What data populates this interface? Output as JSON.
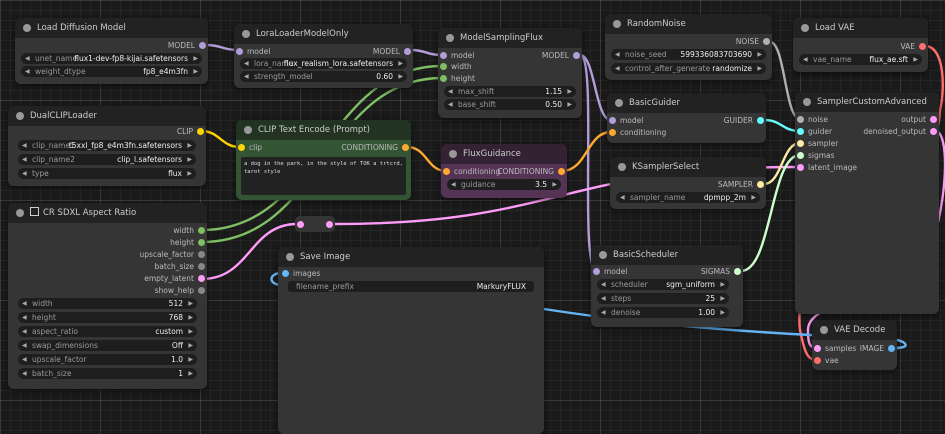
{
  "colors": {
    "model": "#b39ddb",
    "clip": "#ffd500",
    "conditioning": "#ffa931",
    "int": "#7ebf63",
    "latent": "#ff9cf9",
    "noise": "#b0b0b0",
    "guider": "#66ffff",
    "sampler": "#ffeca3",
    "sigmas": "#cdffcd",
    "image": "#64b5f6",
    "vae": "#ff6e6e"
  },
  "nodes": {
    "load_diffusion_model": {
      "title": "Load Diffusion Model",
      "outputs": {
        "model": "MODEL"
      },
      "widgets": {
        "unet_name": {
          "label": "unet_name",
          "value": "flux1-dev-fp8-kijai.safetensors"
        },
        "weight_dtype": {
          "label": "weight_dtype",
          "value": "fp8_e4m3fn"
        }
      }
    },
    "lora_loader": {
      "title": "LoraLoaderModelOnly",
      "inputs": {
        "model": "model"
      },
      "outputs": {
        "model": "MODEL"
      },
      "widgets": {
        "lora_name": {
          "label": "lora_name",
          "value": "flux_realism_lora.safetensors"
        },
        "strength_model": {
          "label": "strength_model",
          "value": "0.60"
        }
      }
    },
    "model_sampling_flux": {
      "title": "ModelSamplingFlux",
      "inputs": {
        "model": "model",
        "width": "width",
        "height": "height"
      },
      "outputs": {
        "model": "MODEL"
      },
      "widgets": {
        "max_shift": {
          "label": "max_shift",
          "value": "1.15"
        },
        "base_shift": {
          "label": "base_shift",
          "value": "0.50"
        }
      }
    },
    "random_noise": {
      "title": "RandomNoise",
      "outputs": {
        "noise": "NOISE"
      },
      "widgets": {
        "noise_seed": {
          "label": "noise_seed",
          "value": "599336083703690"
        },
        "control_after_generate": {
          "label": "control_after_generate",
          "value": "randomize"
        }
      }
    },
    "load_vae": {
      "title": "Load VAE",
      "outputs": {
        "vae": "VAE"
      },
      "widgets": {
        "vae_name": {
          "label": "vae_name",
          "value": "flux_ae.sft"
        }
      }
    },
    "dual_clip_loader": {
      "title": "DualCLIPLoader",
      "outputs": {
        "clip": "CLIP"
      },
      "widgets": {
        "clip_name1": {
          "label": "clip_name1",
          "value": "t5xxl_fp8_e4m3fn.safetensors"
        },
        "clip_name2": {
          "label": "clip_name2",
          "value": "clip_l.safetensors"
        },
        "type": {
          "label": "type",
          "value": "flux"
        }
      }
    },
    "clip_text_encode": {
      "title": "CLIP Text Encode (Prompt)",
      "inputs": {
        "clip": "clip"
      },
      "outputs": {
        "conditioning": "CONDITIONING"
      },
      "text": "a dog in the park, in the style of TOK a trtcrd, tarot style"
    },
    "flux_guidance": {
      "title": "FluxGuidance",
      "inputs": {
        "conditioning": "conditioning"
      },
      "outputs": {
        "conditioning": "CONDITIONING"
      },
      "widgets": {
        "guidance": {
          "label": "guidance",
          "value": "3.5"
        }
      }
    },
    "basic_guider": {
      "title": "BasicGuider",
      "inputs": {
        "model": "model",
        "conditioning": "conditioning"
      },
      "outputs": {
        "guider": "GUIDER"
      }
    },
    "ksampler_select": {
      "title": "KSamplerSelect",
      "outputs": {
        "sampler": "SAMPLER"
      },
      "widgets": {
        "sampler_name": {
          "label": "sampler_name",
          "value": "dpmpp_2m"
        }
      }
    },
    "sampler_custom_advanced": {
      "title": "SamplerCustomAdvanced",
      "inputs": {
        "noise": "noise",
        "guider": "guider",
        "sampler": "sampler",
        "sigmas": "sigmas",
        "latent_image": "latent_image"
      },
      "outputs": {
        "output": "output",
        "denoised_output": "denoised_output"
      }
    },
    "cr_sdxl_aspect_ratio": {
      "title": "CR SDXL Aspect Ratio",
      "outputs": {
        "width": "width",
        "height": "height",
        "upscale_factor": "upscale_factor",
        "batch_size": "batch_size",
        "empty_latent": "empty_latent",
        "show_help": "show_help"
      },
      "widgets": {
        "width": {
          "label": "width",
          "value": "512"
        },
        "height": {
          "label": "height",
          "value": "768"
        },
        "aspect_ratio": {
          "label": "aspect_ratio",
          "value": "custom"
        },
        "swap_dimensions": {
          "label": "swap_dimensions",
          "value": "Off"
        },
        "upscale_factor": {
          "label": "upscale_factor",
          "value": "1.0"
        },
        "batch_size": {
          "label": "batch_size",
          "value": "1"
        }
      }
    },
    "save_image": {
      "title": "Save Image",
      "inputs": {
        "images": "images"
      },
      "widgets": {
        "filename_prefix": {
          "label": "filename_prefix",
          "value": "MarkuryFLUX"
        }
      }
    },
    "basic_scheduler": {
      "title": "BasicScheduler",
      "inputs": {
        "model": "model"
      },
      "outputs": {
        "sigmas": "SIGMAS"
      },
      "widgets": {
        "scheduler": {
          "label": "scheduler",
          "value": "sgm_uniform"
        },
        "steps": {
          "label": "steps",
          "value": "25"
        },
        "denoise": {
          "label": "denoise",
          "value": "1.00"
        }
      }
    },
    "vae_decode": {
      "title": "VAE Decode",
      "inputs": {
        "samples": "samples",
        "vae": "vae"
      },
      "outputs": {
        "image": "IMAGE"
      }
    }
  }
}
